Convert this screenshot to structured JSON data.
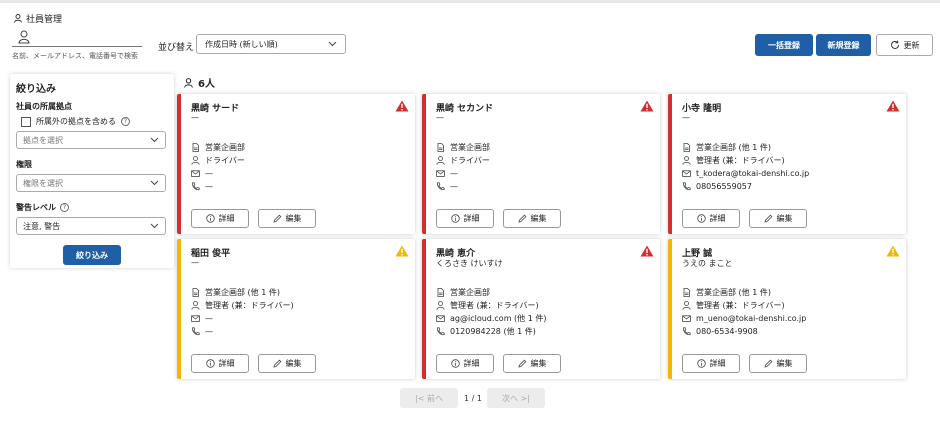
{
  "header": {
    "title": "社員管理",
    "search_placeholder": "名前、メールアドレス、電話番号で検索",
    "sort_label": "並び替え",
    "sort_value": "作成日時 (新しい順)",
    "bulk_button": "一括登録",
    "new_button": "新規登録",
    "refresh_button": "更新"
  },
  "filter": {
    "title": "絞り込み",
    "location_label": "社員の所属拠点",
    "include_other_label": "所属外の拠点を含める",
    "location_placeholder": "拠点を選択",
    "role_label": "権限",
    "role_placeholder": "権限を選択",
    "alert_label": "警告レベル",
    "alert_value": "注意, 警告",
    "apply_button": "絞り込み"
  },
  "result_count": "6人",
  "colors": {
    "danger": "#d32f2f",
    "warning": "#f2b705",
    "primary": "#1f5fa6"
  },
  "cards": [
    {
      "name": "黒崎 サード",
      "kana": "—",
      "dept": "営業企画部",
      "role": "ドライバー",
      "email": "—",
      "phone": "—",
      "level": "danger",
      "detail": "詳細",
      "edit": "編集"
    },
    {
      "name": "黒崎 セカンド",
      "kana": "—",
      "dept": "営業企画部",
      "role": "ドライバー",
      "email": "—",
      "phone": "—",
      "level": "danger",
      "detail": "詳細",
      "edit": "編集"
    },
    {
      "name": "小寺 隆明",
      "kana": "—",
      "dept": "営業企画部 (他 1 件)",
      "role": "管理者 (兼：ドライバー)",
      "email": "t_kodera@tokai-denshi.co.jp",
      "phone": "08056559057",
      "level": "danger",
      "detail": "詳細",
      "edit": "編集"
    },
    {
      "name": "稲田 俊平",
      "kana": "—",
      "dept": "営業企画部 (他 1 件)",
      "role": "管理者 (兼：ドライバー)",
      "email": "—",
      "phone": "—",
      "level": "warning",
      "detail": "詳細",
      "edit": "編集"
    },
    {
      "name": "黒崎 恵介",
      "kana": "くろさき けいすけ",
      "dept": "営業企画部",
      "role": "管理者 (兼：ドライバー)",
      "email": "ag@icloud.com (他 1 件)",
      "phone": "0120984228 (他 1 件)",
      "level": "danger",
      "detail": "詳細",
      "edit": "編集"
    },
    {
      "name": "上野 誠",
      "kana": "うえの まこと",
      "dept": "営業企画部 (他 1 件)",
      "role": "管理者 (兼：ドライバー)",
      "email": "m_ueno@tokai-denshi.co.jp",
      "phone": "080-6534-9908",
      "level": "warning",
      "detail": "詳細",
      "edit": "編集"
    }
  ],
  "pager": {
    "prev": "前へ",
    "page_info": "1 / 1",
    "next": "次へ"
  }
}
